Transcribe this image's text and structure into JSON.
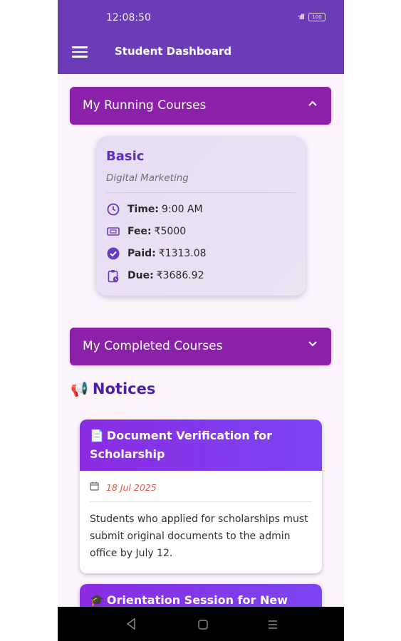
{
  "status_bar": {
    "time": "12:08:50",
    "signal": "ᐧıll",
    "battery": "100"
  },
  "app_bar": {
    "title": "Student Dashboard"
  },
  "running_courses": {
    "title": "My Running Courses",
    "course": {
      "level": "Basic",
      "name": "Digital Marketing",
      "time_label": "Time:",
      "time_value": "9:00 AM",
      "fee_label": "Fee:",
      "fee_value": "₹5000",
      "paid_label": "Paid:",
      "paid_value": "₹1313.08",
      "due_label": "Due:",
      "due_value": "₹3686.92"
    }
  },
  "completed_courses": {
    "title": "My Completed Courses"
  },
  "notices": {
    "icon": "📢",
    "title": "Notices",
    "items": [
      {
        "icon": "📄",
        "title": "Document Verification for Scholarship",
        "date": "18 Jul 2025",
        "body": "Students who applied for scholarships must submit original documents to the admin office by July 12."
      },
      {
        "icon": "🎓",
        "title": "Orientation Session for New"
      }
    ]
  },
  "colors": {
    "app_bar": "#6a3db7",
    "tile": "#8a21a8",
    "accent": "#5c2ebf",
    "date": "#e0574d"
  }
}
